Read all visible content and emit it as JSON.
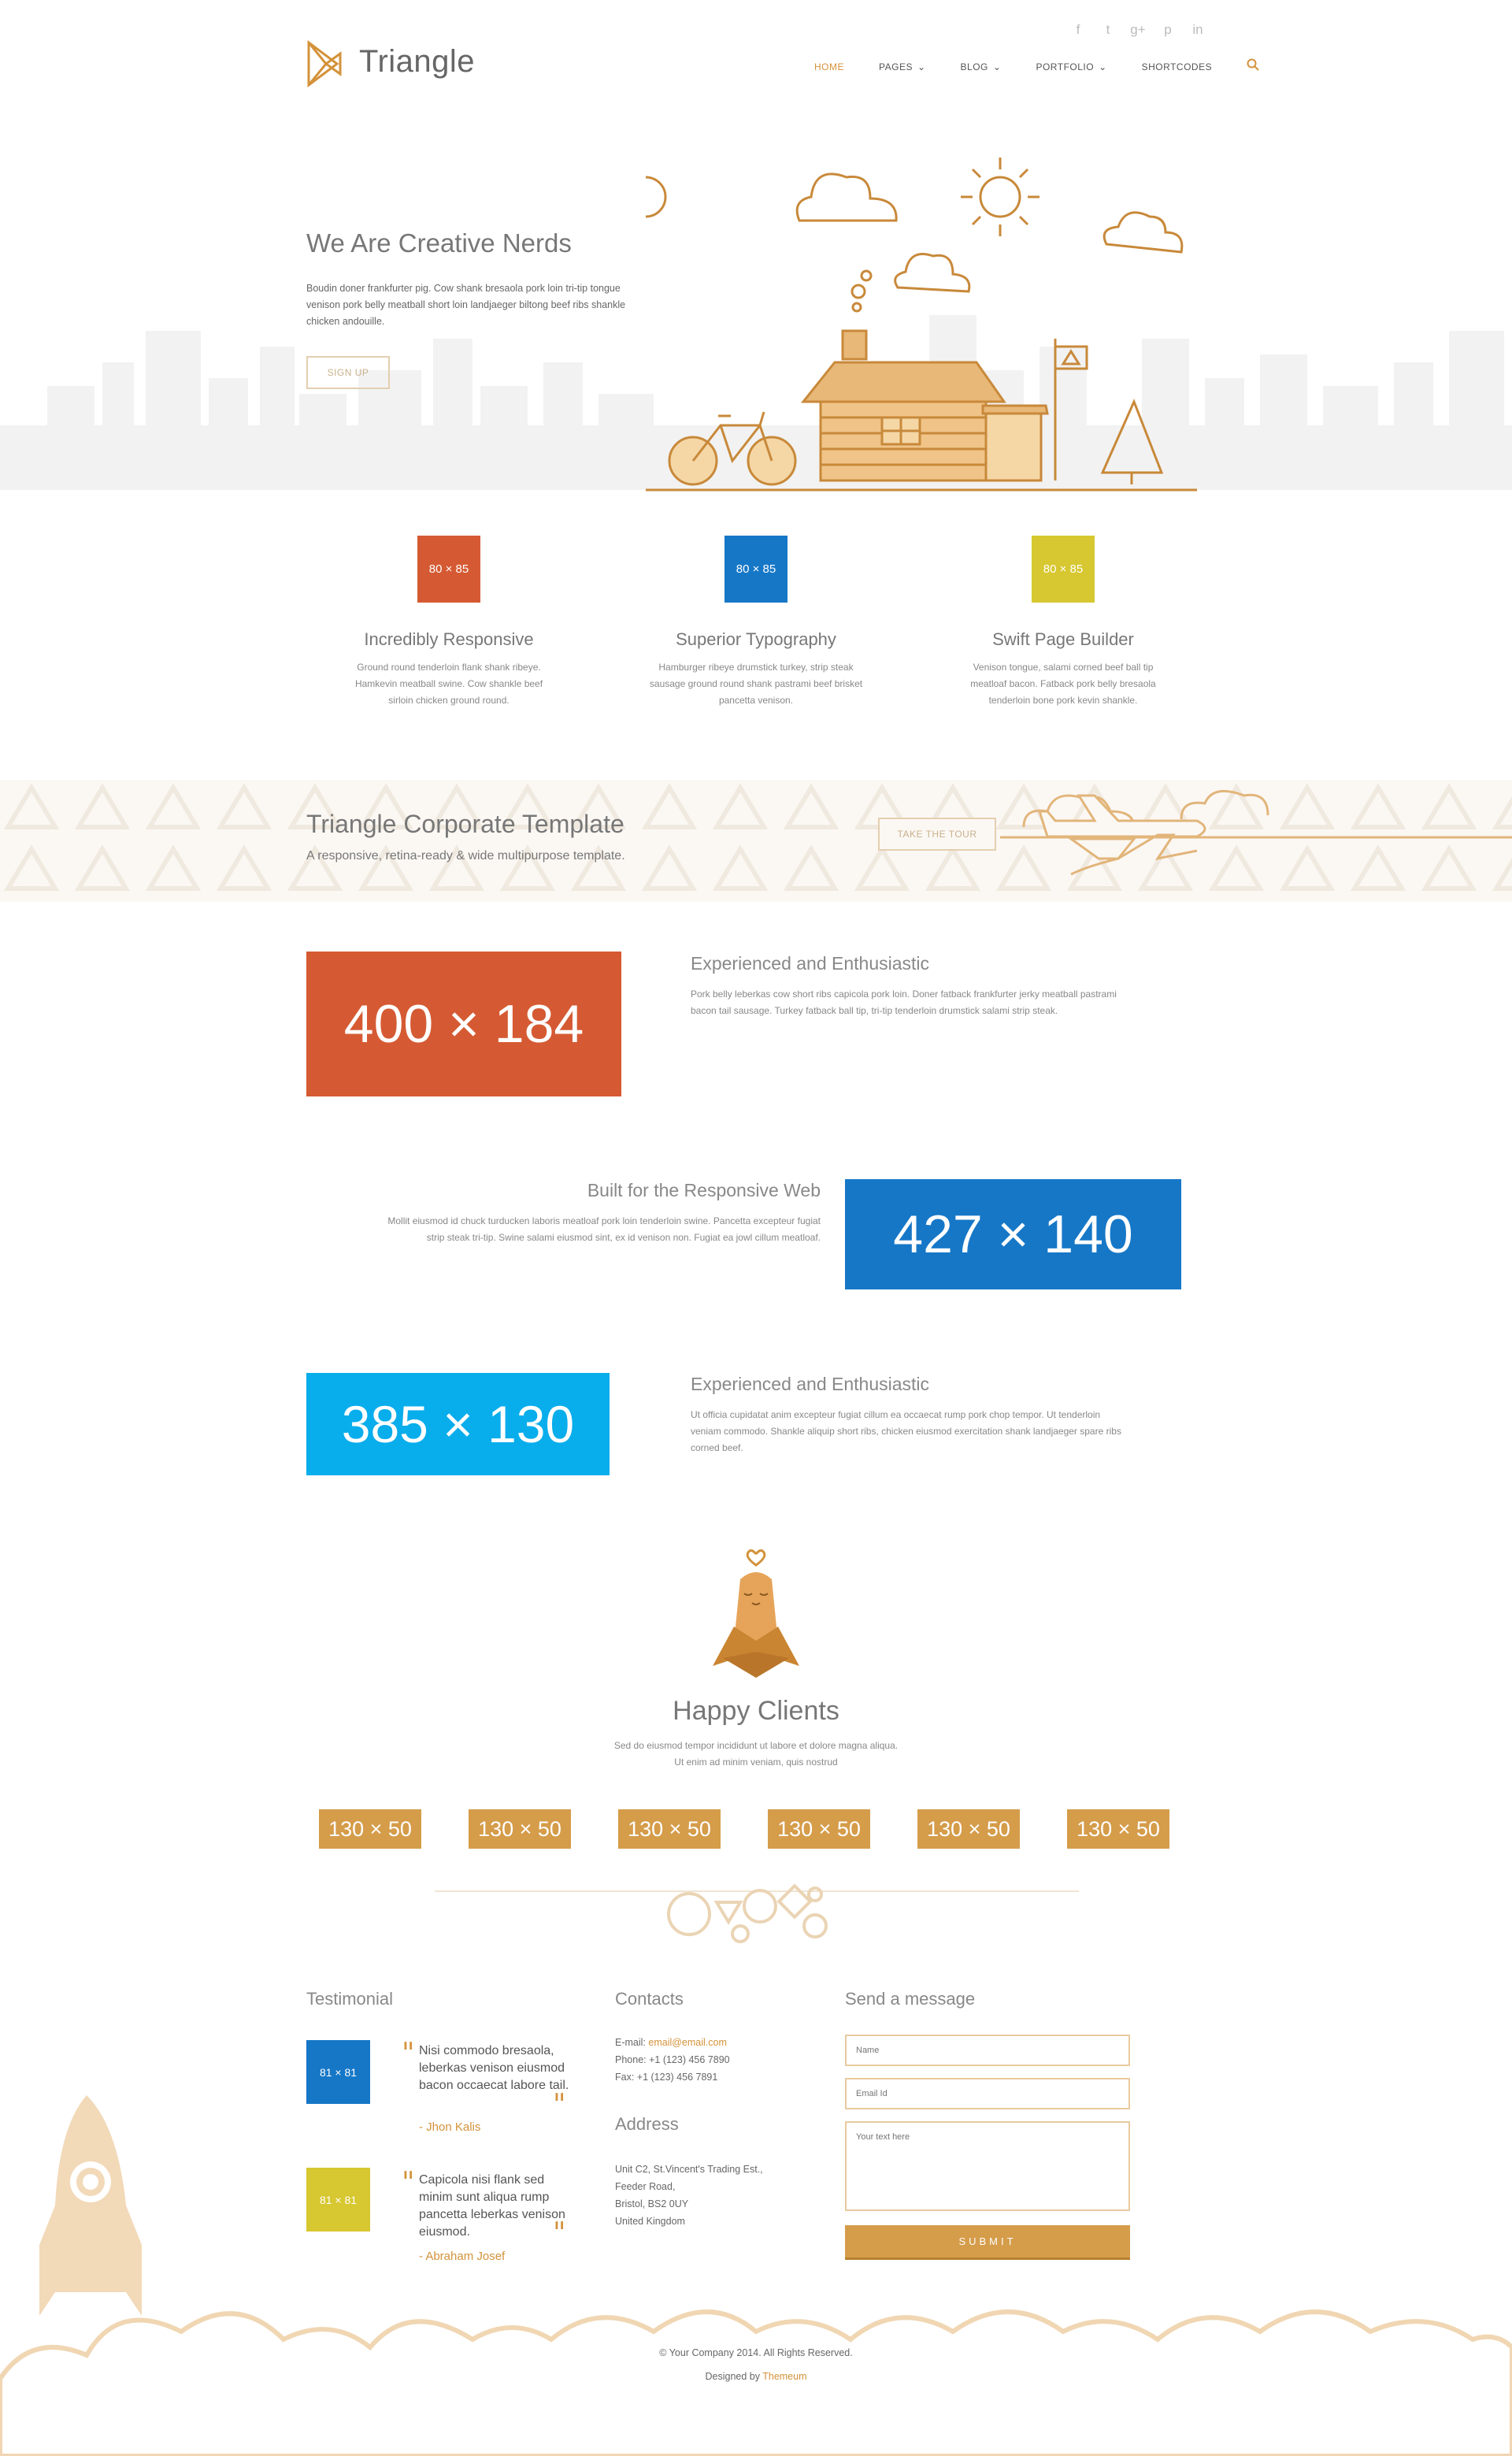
{
  "header": {
    "logo_text": "Triangle",
    "social": [
      "f",
      "t",
      "g+",
      "p",
      "in"
    ],
    "nav": [
      {
        "label": "HOME",
        "has_dropdown": false,
        "active": true
      },
      {
        "label": "PAGES",
        "has_dropdown": true,
        "active": false
      },
      {
        "label": "BLOG",
        "has_dropdown": true,
        "active": false
      },
      {
        "label": "PORTFOLIO",
        "has_dropdown": true,
        "active": false
      },
      {
        "label": "SHORTCODES",
        "has_dropdown": false,
        "active": false
      }
    ],
    "search_icon": "search-icon",
    "dropdown_glyph": "⌄"
  },
  "hero": {
    "title": "We Are Creative Nerds",
    "text": "Boudin doner frankfurter pig. Cow shank bresaola pork loin tri-tip tongue venison pork belly meatball short loin landjaeger biltong beef ribs shankle chicken andouille.",
    "button": "SIGN UP"
  },
  "features": [
    {
      "placeholder": "80 × 85",
      "color": "#d55a33",
      "title": "Incredibly Responsive",
      "text": "Ground round tenderloin flank shank ribeye. Hamkevin meatball swine. Cow shankle beef sirloin chicken ground round."
    },
    {
      "placeholder": "80 × 85",
      "color": "#1677c7",
      "title": "Superior Typography",
      "text": "Hamburger ribeye drumstick turkey, strip steak sausage ground round shank pastrami beef brisket pancetta venison."
    },
    {
      "placeholder": "80 × 85",
      "color": "#d7c730",
      "title": "Swift Page Builder",
      "text": "Venison tongue, salami corned beef ball tip meatloaf bacon. Fatback pork belly bresaola tenderloin bone pork kevin shankle."
    }
  ],
  "action": {
    "title": "Triangle Corporate Template",
    "subtitle": "A responsive, retina-ready & wide multipurpose template.",
    "button": "TAKE THE TOUR"
  },
  "rows": [
    {
      "placeholder": "400 × 184",
      "color": "#d55a33",
      "title": "Experienced and Enthusiastic",
      "text": "Pork belly leberkas cow short ribs capicola pork loin. Doner fatback frankfurter jerky meatball pastrami bacon tail sausage. Turkey fatback ball tip, tri-tip tenderloin drumstick salami strip steak."
    },
    {
      "placeholder": "427 × 140",
      "color": "#1677c7",
      "title": "Built for the Responsive Web",
      "text": "Mollit eiusmod id chuck turducken laboris meatloaf pork loin tenderloin swine. Pancetta excepteur fugiat strip steak tri-tip. Swine salami eiusmod sint, ex id venison non. Fugiat ea jowl cillum meatloaf."
    },
    {
      "placeholder": "385 × 130",
      "color": "#08adec",
      "title": "Experienced and Enthusiastic",
      "text": "Ut officia cupidatat anim excepteur fugiat cillum ea occaecat rump pork chop tempor. Ut tenderloin veniam commodo. Shankle aliquip short ribs, chicken eiusmod exercitation shank landjaeger spare ribs corned beef."
    }
  ],
  "clients": {
    "title": "Happy Clients",
    "text_line1": "Sed do eiusmod tempor incididunt ut labore et dolore magna aliqua.",
    "text_line2": "Ut enim ad minim veniam, quis nostrud",
    "logos": [
      "130 × 50",
      "130 × 50",
      "130 × 50",
      "130 × 50",
      "130 × 50",
      "130 × 50"
    ]
  },
  "footer": {
    "testimonial_heading": "Testimonial",
    "testimonials": [
      {
        "avatar": "81 × 81",
        "color": "#1677c7",
        "quote": "Nisi commodo bresaola, leberkas venison eiusmod bacon occaecat labore tail.",
        "author": "- Jhon Kalis"
      },
      {
        "avatar": "81 × 81",
        "color": "#d7c730",
        "quote": "Capicola nisi flank sed minim sunt aliqua rump pancetta leberkas venison eiusmod.",
        "author": "- Abraham Josef"
      }
    ],
    "contacts_heading": "Contacts",
    "email_label": "E-mail: ",
    "email": "email@email.com",
    "phone": "Phone: +1 (123) 456 7890",
    "fax": "Fax: +1 (123) 456 7891",
    "address_heading": "Address",
    "address_lines": [
      "Unit C2, St.Vincent's Trading Est.,",
      "Feeder Road,",
      "Bristol, BS2 0UY",
      "United Kingdom"
    ],
    "message_heading": "Send a message",
    "name_placeholder": "Name",
    "email_placeholder": "Email Id",
    "text_placeholder": "Your text here",
    "submit": "SUBMIT",
    "copyright": "© Your Company 2014. All Rights Reserved.",
    "designed_by": "Designed by ",
    "designer": "Themeum"
  },
  "colors": {
    "accent": "#d4923a",
    "line_art": "#c8893a"
  }
}
